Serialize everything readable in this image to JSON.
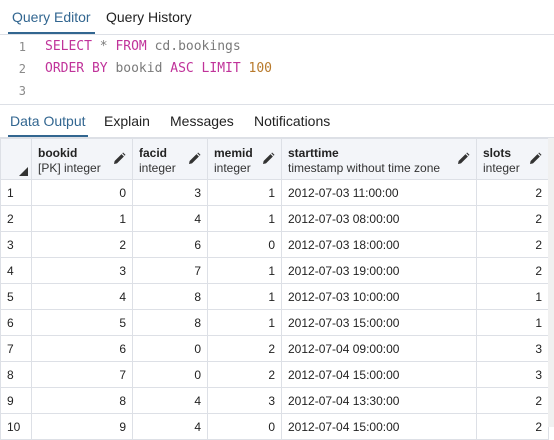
{
  "query_tabs": [
    "Query Editor",
    "Query History"
  ],
  "editor": {
    "line_numbers": [
      "1",
      "2",
      "3"
    ],
    "line1": {
      "kw1": "SELECT",
      "star": " * ",
      "kw2": "FROM",
      "ident": " cd.bookings"
    },
    "line2": {
      "kw1": "ORDER BY",
      "ident": " bookid ",
      "kw2": "ASC LIMIT",
      "num": " 100"
    }
  },
  "output_tabs": [
    "Data Output",
    "Explain",
    "Messages",
    "Notifications"
  ],
  "icons": {
    "corner": "select-all-triangle-icon",
    "edit": "pencil-icon"
  },
  "colors": {
    "accent": "#326690",
    "keyword": "#c0339a",
    "number": "#b87a2c"
  },
  "columns": [
    {
      "name": "bookid",
      "type": "[PK] integer"
    },
    {
      "name": "facid",
      "type": "integer"
    },
    {
      "name": "memid",
      "type": "integer"
    },
    {
      "name": "starttime",
      "type": "timestamp without time zone"
    },
    {
      "name": "slots",
      "type": "integer"
    }
  ],
  "rows": [
    [
      "1",
      "0",
      "3",
      "1",
      "2012-07-03 11:00:00",
      "2"
    ],
    [
      "2",
      "1",
      "4",
      "1",
      "2012-07-03 08:00:00",
      "2"
    ],
    [
      "3",
      "2",
      "6",
      "0",
      "2012-07-03 18:00:00",
      "2"
    ],
    [
      "4",
      "3",
      "7",
      "1",
      "2012-07-03 19:00:00",
      "2"
    ],
    [
      "5",
      "4",
      "8",
      "1",
      "2012-07-03 10:00:00",
      "1"
    ],
    [
      "6",
      "5",
      "8",
      "1",
      "2012-07-03 15:00:00",
      "1"
    ],
    [
      "7",
      "6",
      "0",
      "2",
      "2012-07-04 09:00:00",
      "3"
    ],
    [
      "8",
      "7",
      "0",
      "2",
      "2012-07-04 15:00:00",
      "3"
    ],
    [
      "9",
      "8",
      "4",
      "3",
      "2012-07-04 13:30:00",
      "2"
    ],
    [
      "10",
      "9",
      "4",
      "0",
      "2012-07-04 15:00:00",
      "2"
    ]
  ]
}
